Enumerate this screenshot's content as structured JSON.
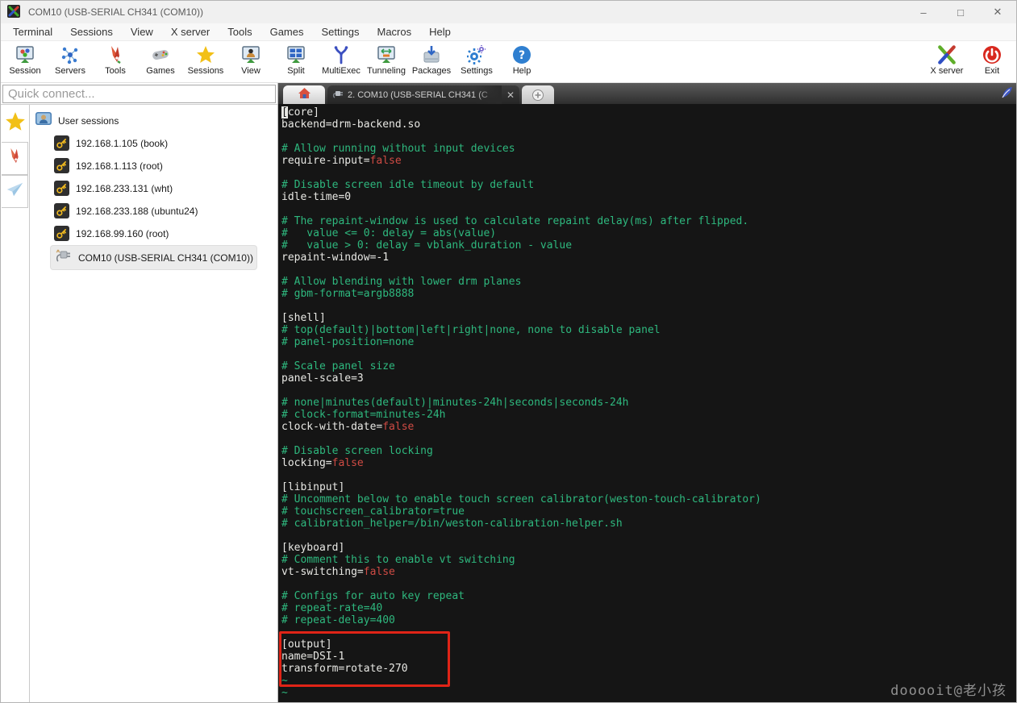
{
  "window": {
    "title": "COM10  (USB-SERIAL CH341 (COM10))",
    "controls": [
      {
        "name": "minimize-button",
        "glyph": "–"
      },
      {
        "name": "maximize-button",
        "glyph": "□"
      },
      {
        "name": "close-button",
        "glyph": "✕"
      }
    ]
  },
  "menubar": {
    "items": [
      "Terminal",
      "Sessions",
      "View",
      "X server",
      "Tools",
      "Games",
      "Settings",
      "Macros",
      "Help"
    ]
  },
  "toolbar": {
    "left": [
      {
        "label": "Session",
        "icon": "session-icon"
      },
      {
        "label": "Servers",
        "icon": "servers-icon"
      },
      {
        "label": "Tools",
        "icon": "tools-icon"
      },
      {
        "label": "Games",
        "icon": "games-icon"
      },
      {
        "label": "Sessions",
        "icon": "sessions-star-icon"
      },
      {
        "label": "View",
        "icon": "view-icon"
      },
      {
        "label": "Split",
        "icon": "split-icon"
      },
      {
        "label": "MultiExec",
        "icon": "multiexec-icon"
      },
      {
        "label": "Tunneling",
        "icon": "tunneling-icon"
      },
      {
        "label": "Packages",
        "icon": "packages-icon"
      },
      {
        "label": "Settings",
        "icon": "settings-icon"
      },
      {
        "label": "Help",
        "icon": "help-icon"
      }
    ],
    "right": [
      {
        "label": "X server",
        "icon": "xserver-icon"
      },
      {
        "label": "Exit",
        "icon": "exit-icon"
      }
    ]
  },
  "sidebar": {
    "quick_connect_placeholder": "Quick connect...",
    "rail": [
      {
        "name": "favorites-star-icon",
        "style": "plain"
      },
      {
        "name": "tools-knife-icon",
        "style": "button"
      },
      {
        "name": "shared-plane-icon",
        "style": "button"
      }
    ],
    "tree": {
      "root_label": "User sessions",
      "items": [
        {
          "label": "192.168.1.105 (book)",
          "icon": "ssh-key-icon",
          "selected": false
        },
        {
          "label": "192.168.1.113 (root)",
          "icon": "ssh-key-icon",
          "selected": false
        },
        {
          "label": "192.168.233.131 (wht)",
          "icon": "ssh-key-icon",
          "selected": false
        },
        {
          "label": "192.168.233.188 (ubuntu24)",
          "icon": "ssh-key-icon",
          "selected": false
        },
        {
          "label": "192.168.99.160 (root)",
          "icon": "ssh-key-icon",
          "selected": false
        },
        {
          "label": "COM10  (USB-SERIAL CH341 (COM10))",
          "icon": "serial-port-icon",
          "selected": true
        }
      ]
    }
  },
  "tabs": {
    "active_label": "2. COM10  (USB-SERIAL CH341 (C",
    "close_glyph": "✕",
    "new_tab_glyph": "＋"
  },
  "terminal": {
    "colors": {
      "background": "#151515",
      "foreground": "#e8e8e4",
      "comment_green": "#2eb87e",
      "value_red": "#cf4b44",
      "annotation_red": "#e02417"
    },
    "lines": [
      [
        [
          "cur",
          "["
        ],
        [
          "w",
          "core]"
        ]
      ],
      [
        [
          "w",
          "backend=drm-backend.so"
        ]
      ],
      [],
      [
        [
          "g",
          "# Allow running without input devices"
        ]
      ],
      [
        [
          "w",
          "require-input="
        ],
        [
          "r",
          "false"
        ]
      ],
      [],
      [
        [
          "g",
          "# Disable screen idle timeout by default"
        ]
      ],
      [
        [
          "w",
          "idle-time=0"
        ]
      ],
      [],
      [
        [
          "g",
          "# The repaint-window is used to calculate repaint delay(ms) after flipped."
        ]
      ],
      [
        [
          "g",
          "#   value <= 0: delay = abs(value)"
        ]
      ],
      [
        [
          "g",
          "#   value > 0: delay = vblank_duration - value"
        ]
      ],
      [
        [
          "w",
          "repaint-window=-1"
        ]
      ],
      [],
      [
        [
          "g",
          "# Allow blending with lower drm planes"
        ]
      ],
      [
        [
          "g",
          "# gbm-format=argb8888"
        ]
      ],
      [],
      [
        [
          "w",
          "[shell]"
        ]
      ],
      [
        [
          "g",
          "# top(default)|bottom|left|right|none, none to disable panel"
        ]
      ],
      [
        [
          "g",
          "# panel-position=none"
        ]
      ],
      [],
      [
        [
          "g",
          "# Scale panel size"
        ]
      ],
      [
        [
          "w",
          "panel-scale=3"
        ]
      ],
      [],
      [
        [
          "g",
          "# none|minutes(default)|minutes-24h|seconds|seconds-24h"
        ]
      ],
      [
        [
          "g",
          "# clock-format=minutes-24h"
        ]
      ],
      [
        [
          "w",
          "clock-with-date="
        ],
        [
          "r",
          "false"
        ]
      ],
      [],
      [
        [
          "g",
          "# Disable screen locking"
        ]
      ],
      [
        [
          "w",
          "locking="
        ],
        [
          "r",
          "false"
        ]
      ],
      [],
      [
        [
          "w",
          "[libinput]"
        ]
      ],
      [
        [
          "g",
          "# Uncomment below to enable touch screen calibrator(weston-touch-calibrator)"
        ]
      ],
      [
        [
          "g",
          "# touchscreen_calibrator=true"
        ]
      ],
      [
        [
          "g",
          "# calibration_helper=/bin/weston-calibration-helper.sh"
        ]
      ],
      [],
      [
        [
          "w",
          "[keyboard]"
        ]
      ],
      [
        [
          "g",
          "# Comment this to enable vt switching"
        ]
      ],
      [
        [
          "w",
          "vt-switching="
        ],
        [
          "r",
          "false"
        ]
      ],
      [],
      [
        [
          "g",
          "# Configs for auto key repeat"
        ]
      ],
      [
        [
          "g",
          "# repeat-rate=40"
        ]
      ],
      [
        [
          "g",
          "# repeat-delay=400"
        ]
      ],
      [],
      [
        [
          "w",
          "[output]"
        ]
      ],
      [
        [
          "w",
          "name=DSI-1"
        ]
      ],
      [
        [
          "w",
          "transform=rotate-270"
        ]
      ],
      [
        [
          "g",
          "~"
        ]
      ],
      [
        [
          "g",
          "~"
        ]
      ]
    ]
  },
  "watermark": "dooooit@老小孩"
}
